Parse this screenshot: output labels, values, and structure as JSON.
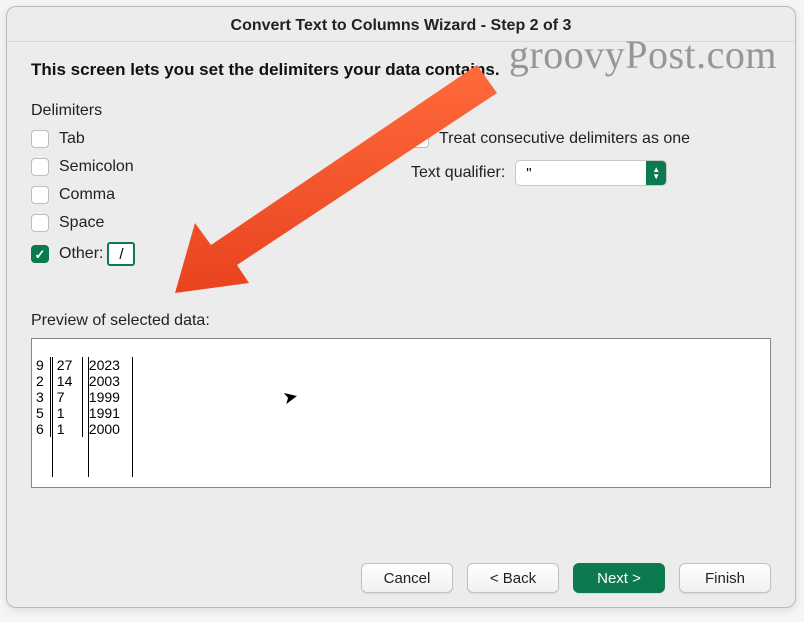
{
  "window_title": "Convert Text to Columns Wizard - Step 2 of 3",
  "instruction": "This screen lets you set the delimiters your data contains.",
  "delimiters_heading": "Delimiters",
  "delimiters": {
    "tab": {
      "label": "Tab",
      "checked": false
    },
    "semicolon": {
      "label": "Semicolon",
      "checked": false
    },
    "comma": {
      "label": "Comma",
      "checked": false
    },
    "space": {
      "label": "Space",
      "checked": false
    },
    "other": {
      "label": "Other:",
      "checked": true,
      "value": "/"
    }
  },
  "treat_consecutive": {
    "label": "Treat consecutive delimiters as one",
    "checked": false
  },
  "text_qualifier": {
    "label": "Text qualifier:",
    "value": "\""
  },
  "preview_label": "Preview of selected data:",
  "preview_rows": [
    [
      "9",
      "27",
      "2023"
    ],
    [
      "2",
      "14",
      "2003"
    ],
    [
      "3",
      "7",
      "1999"
    ],
    [
      "5",
      "1",
      "1991"
    ],
    [
      "6",
      "1",
      "2000"
    ]
  ],
  "buttons": {
    "cancel": "Cancel",
    "back": "< Back",
    "next": "Next >",
    "finish": "Finish"
  },
  "watermark": "groovyPost.com"
}
